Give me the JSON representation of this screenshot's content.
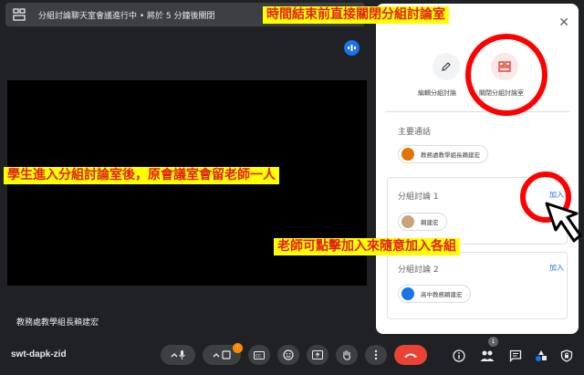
{
  "topbar": {
    "status_text": "分組討論聊天室會議進行中 • 將於 5 分鐘後關閉"
  },
  "video": {
    "presenter_name": "教務處教學組長賴建宏"
  },
  "panel": {
    "close_symbol": "✕",
    "edit_label": "編輯分組討論",
    "close_rooms_label": "關閉分組討論室",
    "main_call_title": "主要通話",
    "main_call_participant": "教務處教學組長賴建宏",
    "rooms": [
      {
        "title": "分組討論 1",
        "join_label": "加入",
        "participant": "賴建宏"
      },
      {
        "title": "分組討論 2",
        "join_label": "加入",
        "participant": "高中教務賴建宏"
      }
    ]
  },
  "annotations": {
    "top": "時間結束前直接關閉分組討論室",
    "left": "學生進入分組討論室後，原會議室會留老師一人",
    "right": "老師可點擊加入來隨意加入各組"
  },
  "bottombar": {
    "meeting_code": "swt-dapk-zid",
    "present_badge": "!",
    "people_count": "1"
  },
  "colors": {
    "background": "#202124",
    "accent_blue": "#1a73e8",
    "hangup_red": "#ea4335",
    "annotation_bg": "#ffff00",
    "annotation_text": "#e0201a",
    "circle_red": "#ff0000"
  }
}
